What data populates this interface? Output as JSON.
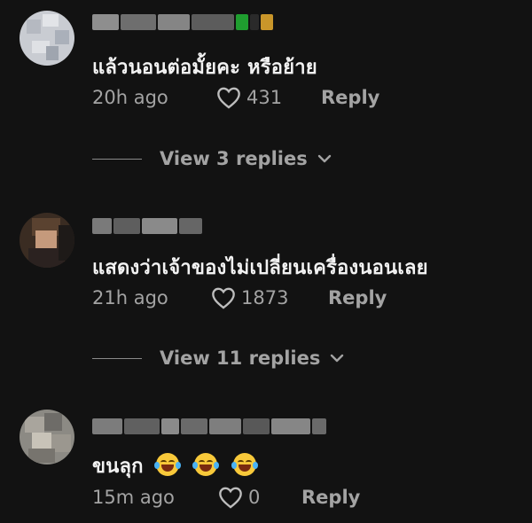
{
  "comments": [
    {
      "text": "แล้วนอนต่อมั้ยคะ หรือย้าย",
      "time": "20h ago",
      "likes": "431",
      "reply_label": "Reply",
      "view_replies": "View 3 replies"
    },
    {
      "text": "แสดงว่าเจ้าของไม่เปลี่ยนเครื่องนอนเลย",
      "time": "21h ago",
      "likes": "1873",
      "reply_label": "Reply",
      "view_replies": "View 11 replies"
    },
    {
      "text": "ขนลุก",
      "time": "15m ago",
      "likes": "0",
      "reply_label": "Reply"
    }
  ],
  "colors": {
    "background": "#121212",
    "text": "#f2f2f2",
    "muted": "#a3a3a3"
  },
  "icons": [
    "heart-outline-icon",
    "chevron-down-icon",
    "face-with-tears-of-joy-emoji"
  ]
}
